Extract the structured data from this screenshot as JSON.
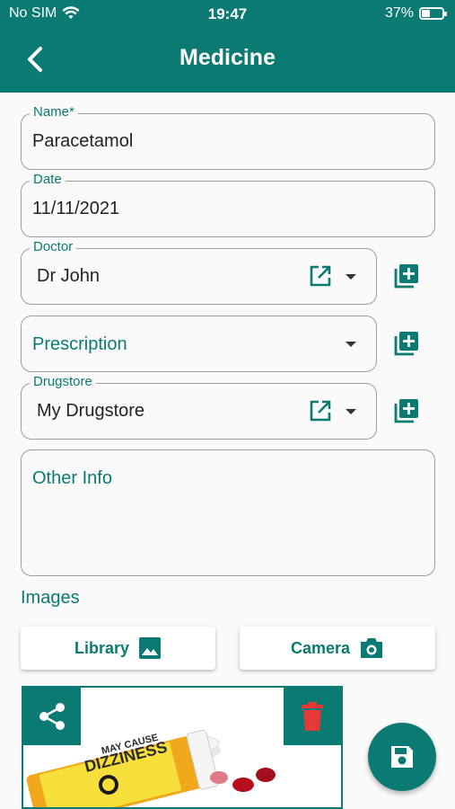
{
  "status_bar": {
    "carrier": "No SIM",
    "time": "19:47",
    "battery": "37%"
  },
  "header": {
    "title": "Medicine"
  },
  "form": {
    "name": {
      "label": "Name*",
      "value": "Paracetamol"
    },
    "date": {
      "label": "Date",
      "value": "11/11/2021"
    },
    "doctor": {
      "label": "Doctor",
      "value": "Dr John"
    },
    "prescription": {
      "placeholder": "Prescription"
    },
    "drugstore": {
      "label": "Drugstore",
      "value": "My Drugstore"
    },
    "other_info": {
      "placeholder": "Other Info"
    }
  },
  "images": {
    "section_title": "Images",
    "library_label": "Library",
    "camera_label": "Camera",
    "photo_text": [
      "MAY CAUSE",
      "DIZZINESS"
    ]
  },
  "colors": {
    "primary": "#0a7a73",
    "delete": "#e53935",
    "background": "#fafafa"
  },
  "icons": [
    "back-icon",
    "wifi-icon",
    "battery-icon",
    "open-external-icon",
    "add-box-icon",
    "image-icon",
    "camera-icon",
    "share-icon",
    "trash-icon",
    "save-icon"
  ]
}
